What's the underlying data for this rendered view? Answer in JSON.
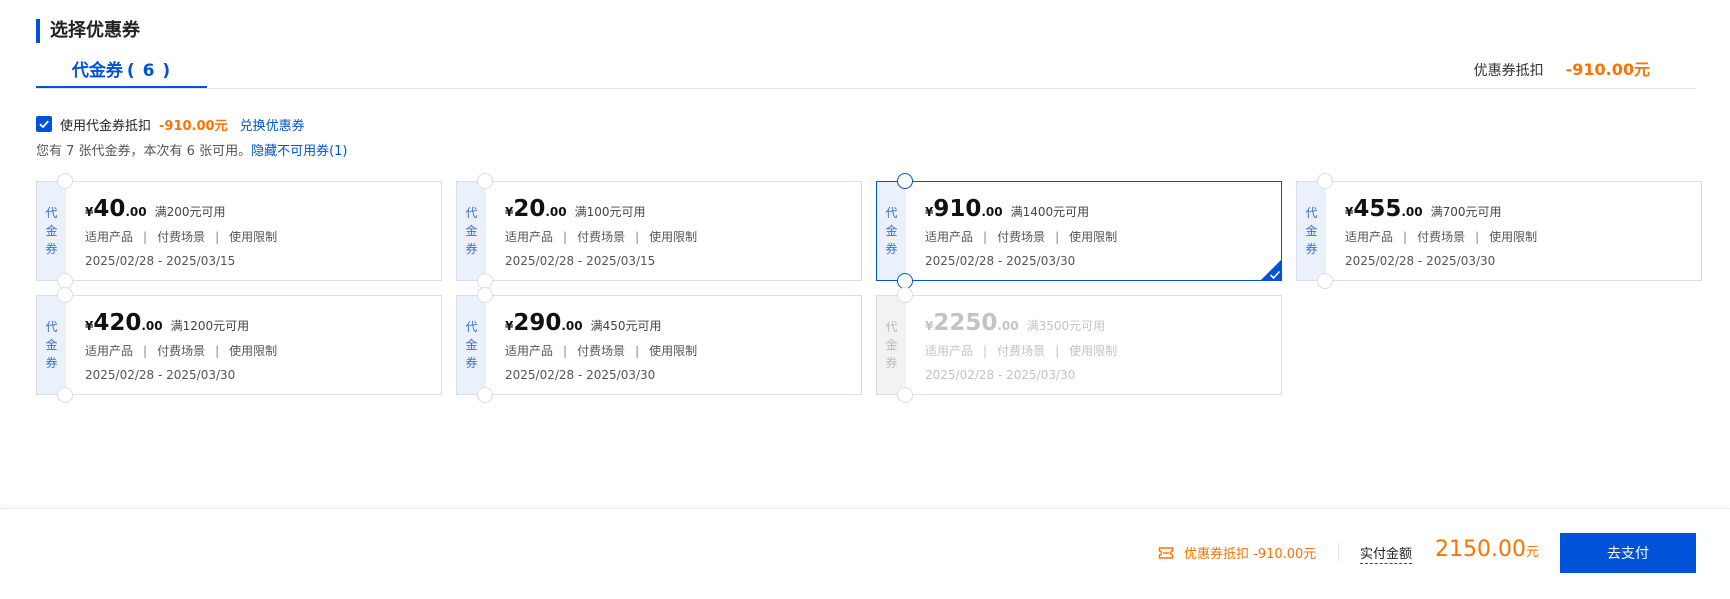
{
  "section_title": "选择优惠券",
  "tab": {
    "label": "代金券",
    "count": "( 6 )"
  },
  "summary": {
    "label": "优惠券抵扣",
    "amount": "-910.00元"
  },
  "use_row": {
    "label": "使用代金券抵扣",
    "deduct": "-910.00元",
    "exchange_link": "兑换优惠券",
    "checked": true
  },
  "hint": {
    "text": "您有 7 张代金券，本次有 6 张可用。",
    "link": "隐藏不可用券(1)"
  },
  "coupon_side": [
    "代",
    "金",
    "券"
  ],
  "coupon_links": {
    "a": "适用产品",
    "b": "付费场景",
    "c": "使用限制",
    "sep": "|"
  },
  "coupons": [
    {
      "yen": "¥",
      "int": "40",
      "dec": ".00",
      "cond": "满200元可用",
      "date": "2025/02/28 - 2025/03/15",
      "selected": false,
      "disabled": false
    },
    {
      "yen": "¥",
      "int": "20",
      "dec": ".00",
      "cond": "满100元可用",
      "date": "2025/02/28 - 2025/03/15",
      "selected": false,
      "disabled": false
    },
    {
      "yen": "¥",
      "int": "910",
      "dec": ".00",
      "cond": "满1400元可用",
      "date": "2025/02/28 - 2025/03/30",
      "selected": true,
      "disabled": false
    },
    {
      "yen": "¥",
      "int": "455",
      "dec": ".00",
      "cond": "满700元可用",
      "date": "2025/02/28 - 2025/03/30",
      "selected": false,
      "disabled": false
    },
    {
      "yen": "¥",
      "int": "420",
      "dec": ".00",
      "cond": "满1200元可用",
      "date": "2025/02/28 - 2025/03/30",
      "selected": false,
      "disabled": false
    },
    {
      "yen": "¥",
      "int": "290",
      "dec": ".00",
      "cond": "满450元可用",
      "date": "2025/02/28 - 2025/03/30",
      "selected": false,
      "disabled": false
    },
    {
      "yen": "¥",
      "int": "2250",
      "dec": ".00",
      "cond": "满3500元可用",
      "date": "2025/02/28 - 2025/03/30",
      "selected": false,
      "disabled": true
    }
  ],
  "footer": {
    "discount_label": "优惠券抵扣 -910.00元",
    "actual_label": "实付金额",
    "total": "2150.00",
    "total_unit": "元",
    "pay_button": "去支付"
  },
  "colors": {
    "primary": "#0052d9",
    "accent": "#ff7200"
  },
  "icons": {
    "ticket": "ticket-icon",
    "check": "check-icon"
  }
}
